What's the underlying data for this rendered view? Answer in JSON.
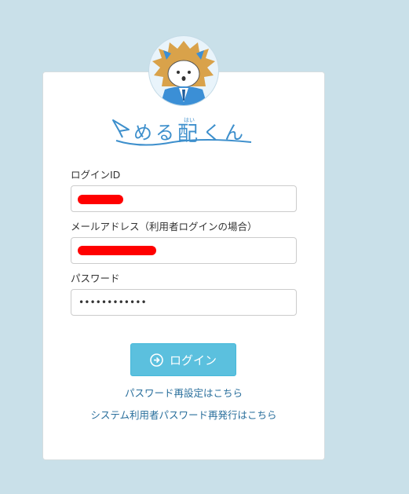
{
  "brand": {
    "logo_text": "めるくん",
    "logo_kanji": "配",
    "logo_ruby": "はい"
  },
  "form": {
    "login_id_label": "ログインID",
    "email_label": "メールアドレス（利用者ログインの場合）",
    "password_label": "パスワード",
    "password_value": "••••••••••••"
  },
  "buttons": {
    "login_label": "ログイン"
  },
  "links": {
    "password_reset": "パスワード再設定はこちら",
    "system_password_reissue": "システム利用者パスワード再発行はこちら"
  },
  "colors": {
    "background": "#c9e0e9",
    "primary": "#5bc0de",
    "link": "#2a6f9c",
    "redaction": "#ff0000"
  }
}
